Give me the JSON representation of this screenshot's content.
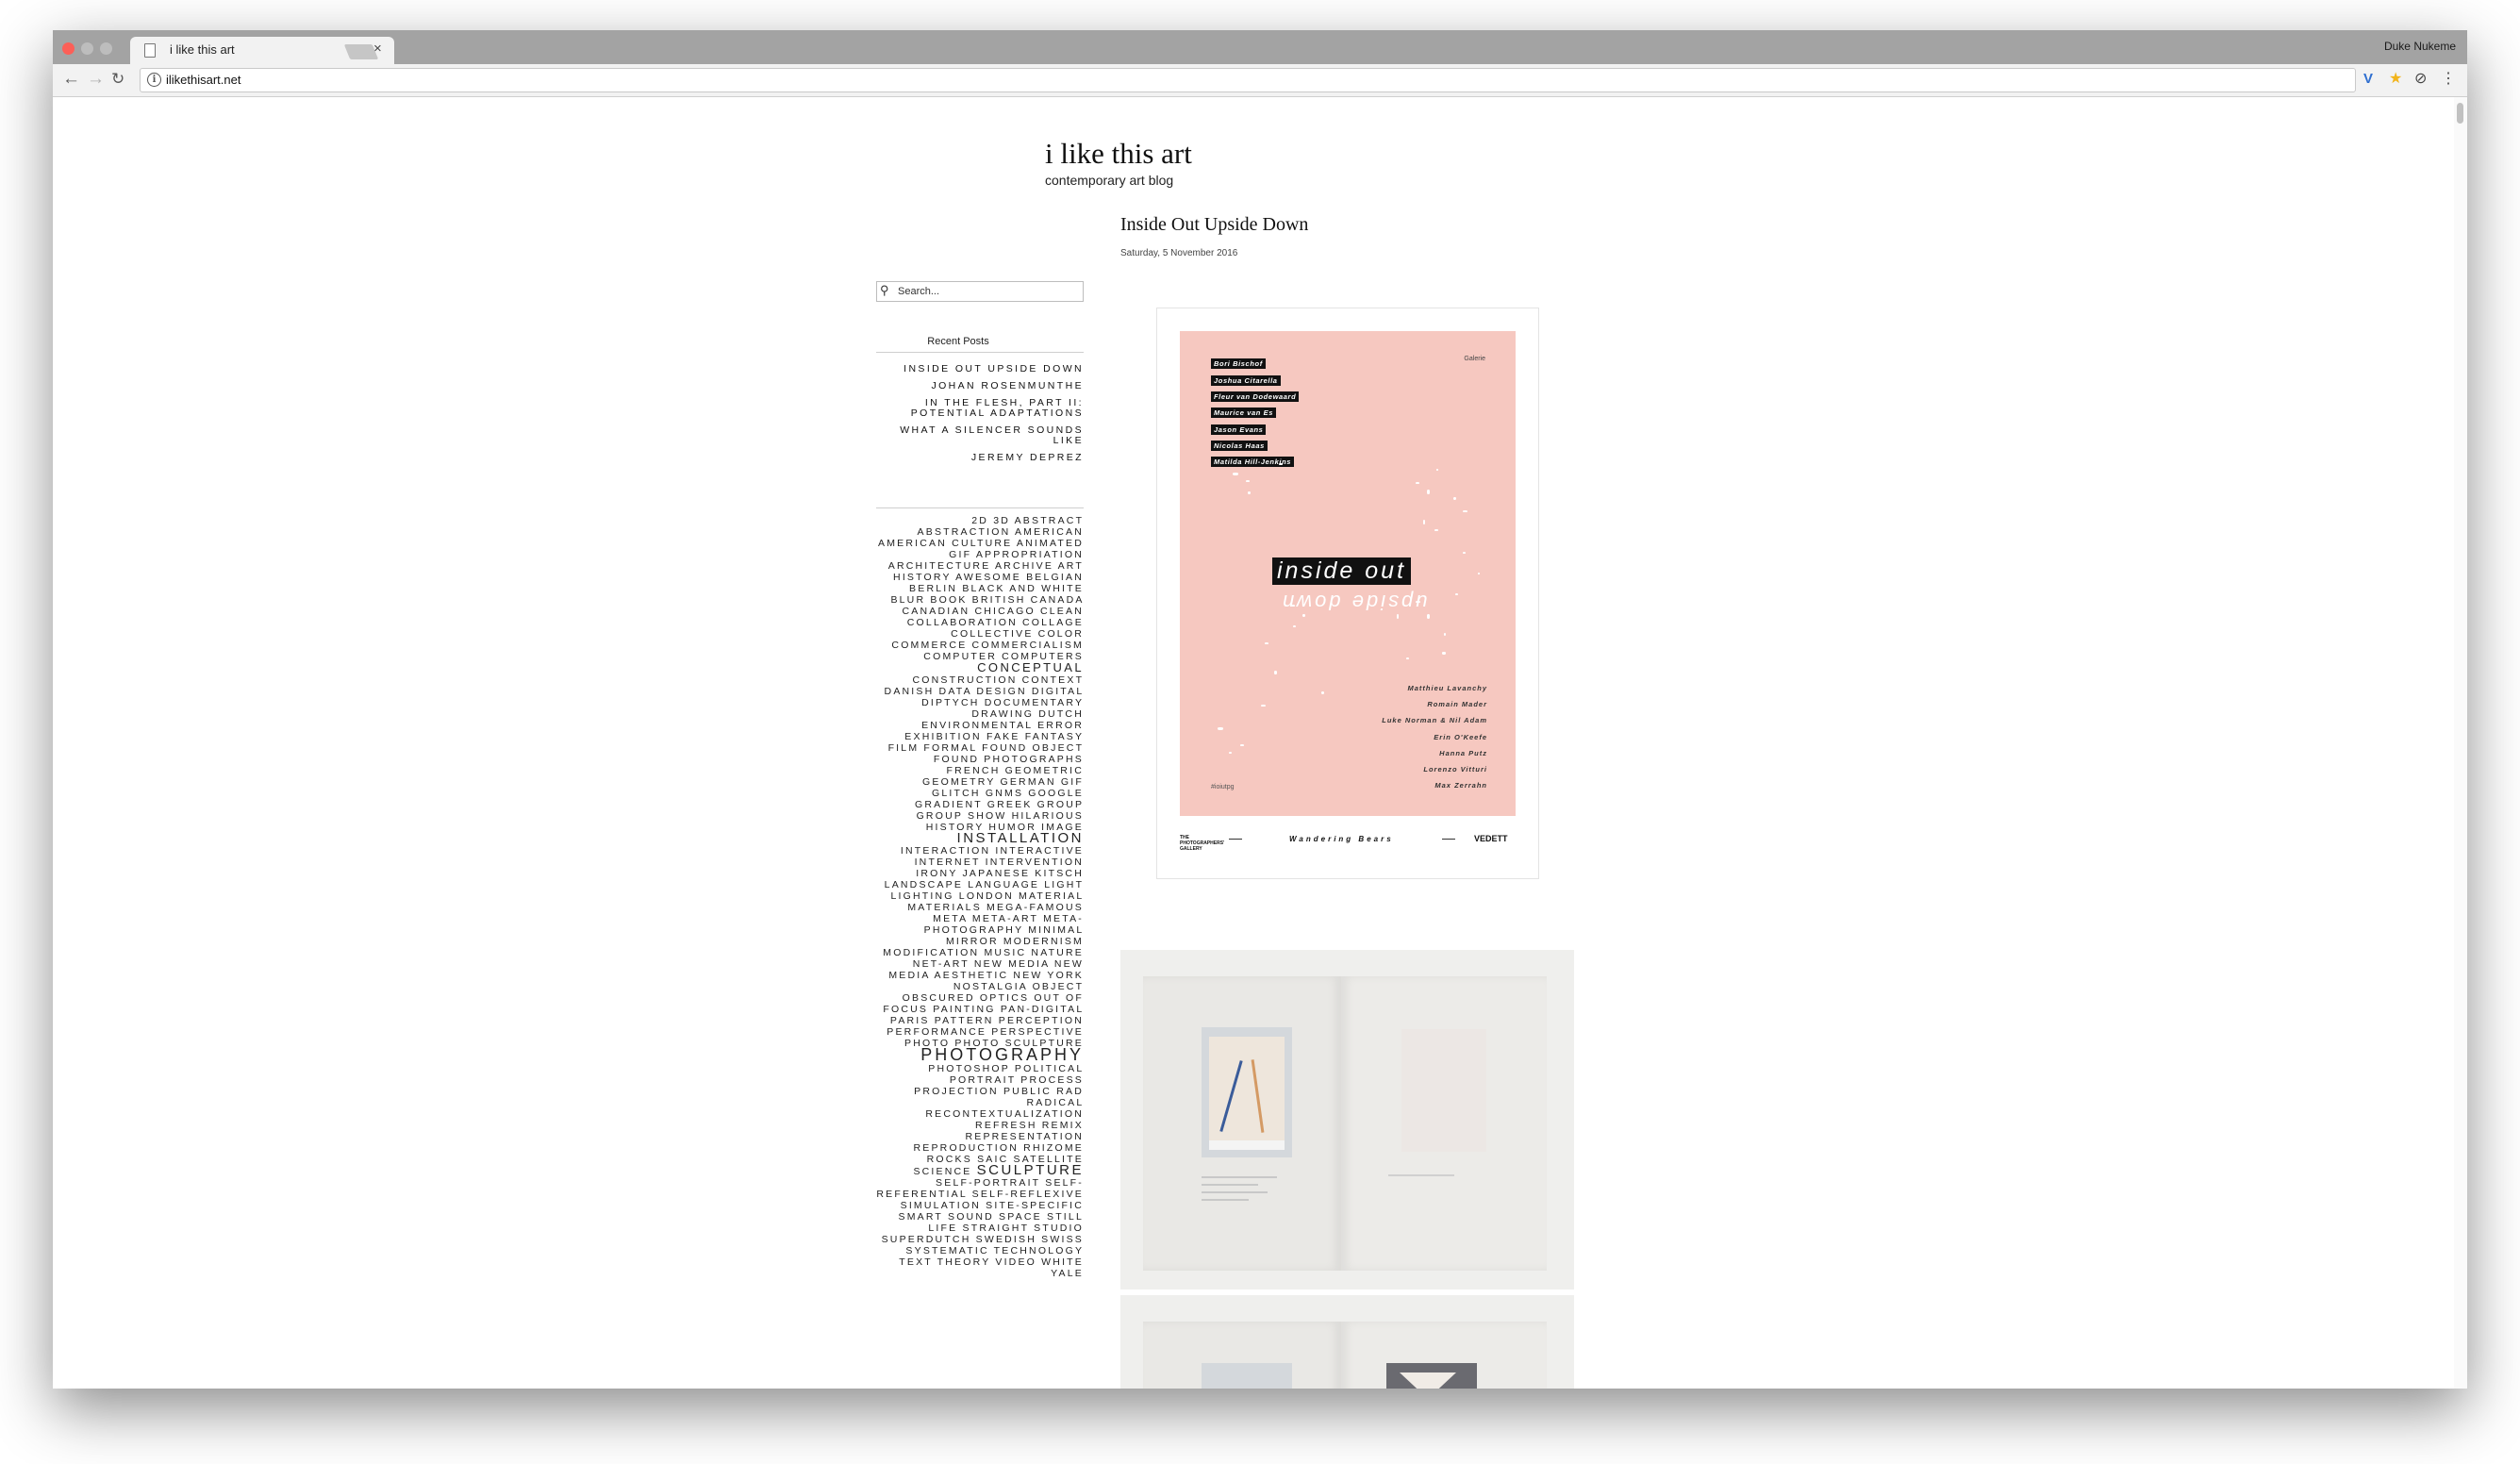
{
  "browser": {
    "tab_title": "i like this art",
    "url": "ilikethisart.net",
    "profile_name": "Duke Nukeme"
  },
  "site": {
    "title": "i like this art",
    "subtitle": "contemporary art blog"
  },
  "post": {
    "title": "Inside Out Upside Down",
    "date": "Saturday, 5 November 2016"
  },
  "search": {
    "placeholder": "Search..."
  },
  "recent_posts": {
    "heading": "Recent Posts",
    "items": [
      "INSIDE OUT UPSIDE DOWN",
      "JOHAN ROSENMUNTHE",
      "IN THE FLESH, PART II: POTENTIAL ADAPTATIONS",
      "WHAT A SILENCER SOUNDS LIKE",
      "JEREMY DEPREZ"
    ]
  },
  "tags": [
    "2D",
    "3D",
    "ABSTRACT",
    "ABSTRACTION",
    "AMERICAN",
    "AMERICAN CULTURE",
    "ANIMATED GIF",
    "APPROPRIATION",
    "ARCHITECTURE",
    "ARCHIVE",
    "ART HISTORY",
    "AWESOME",
    "BELGIAN",
    "BERLIN",
    "BLACK AND WHITE",
    "BLUR",
    "BOOK",
    "BRITISH",
    "CANADA",
    "CANADIAN",
    "CHICAGO",
    "CLEAN",
    "COLLABORATION",
    "COLLAGE",
    "COLLECTIVE",
    "COLOR",
    "COMMERCE",
    "COMMERCIALISM",
    "COMPUTER",
    "COMPUTERS",
    "CONCEPTUAL",
    "CONSTRUCTION",
    "CONTEXT",
    "DANISH",
    "DATA",
    "DESIGN",
    "DIGITAL",
    "DIPTYCH",
    "DOCUMENTARY",
    "DRAWING",
    "DUTCH",
    "ENVIRONMENTAL",
    "ERROR",
    "EXHIBITION",
    "FAKE",
    "FANTASY",
    "FILM",
    "FORMAL",
    "FOUND OBJECT",
    "FOUND PHOTOGRAPHS",
    "FRENCH",
    "GEOMETRIC",
    "GEOMETRY",
    "GERMAN",
    "GIF",
    "GLITCH",
    "GNMS",
    "GOOGLE",
    "GRADIENT",
    "GREEK",
    "GROUP",
    "GROUP SHOW",
    "HILARIOUS",
    "HISTORY",
    "HUMOR",
    "IMAGE",
    "INSTALLATION",
    "INTERACTION",
    "INTERACTIVE",
    "INTERNET",
    "INTERVENTION",
    "IRONY",
    "JAPANESE",
    "KITSCH",
    "LANDSCAPE",
    "LANGUAGE",
    "LIGHT",
    "LIGHTING",
    "LONDON",
    "MATERIAL",
    "MATERIALS",
    "MEGA-FAMOUS",
    "META",
    "META-ART",
    "META-PHOTOGRAPHY",
    "MINIMAL",
    "MIRROR",
    "MODERNISM",
    "MODIFICATION",
    "MUSIC",
    "NATURE",
    "NET-ART",
    "NEW MEDIA",
    "NEW MEDIA AESTHETIC",
    "NEW YORK",
    "NOSTALGIA",
    "OBJECT",
    "OBSCURED",
    "OPTICS",
    "OUT OF FOCUS",
    "PAINTING",
    "PAN-DIGITAL",
    "PARIS",
    "PATTERN",
    "PERCEPTION",
    "PERFORMANCE",
    "PERSPECTIVE",
    "PHOTO",
    "PHOTO SCULPTURE",
    "PHOTOGRAPHY",
    "PHOTOSHOP",
    "POLITICAL",
    "PORTRAIT",
    "PROCESS",
    "PROJECTION",
    "PUBLIC",
    "RAD",
    "RADICAL",
    "RECONTEXTUALIZATION",
    "REFRESH",
    "REMIX",
    "REPRESENTATION",
    "REPRODUCTION",
    "RHIZOME",
    "ROCKS",
    "SAIC",
    "SATELLITE",
    "SCIENCE",
    "SCULPTURE",
    "SELF-PORTRAIT",
    "SELF-REFERENTIAL",
    "SELF-REFLEXIVE",
    "SIMULATION",
    "SITE-SPECIFIC",
    "SMART",
    "SOUND",
    "SPACE",
    "STILL LIFE",
    "STRAIGHT",
    "STUDIO",
    "SUPERDUTCH",
    "SWEDISH",
    "SWISS",
    "SYSTEMATIC",
    "TECHNOLOGY",
    "TEXT",
    "THEORY",
    "VIDEO",
    "WHITE",
    "YALE"
  ],
  "tag_sizes": {
    "CONCEPTUAL": "mid",
    "INSTALLATION": "big",
    "PHOTOGRAPHY": "huge",
    "SCULPTURE": "big"
  },
  "poster": {
    "artists": [
      "Bori Bischof",
      "Joshua Citarella",
      "Fleur van Dodewaard",
      "Maurice van Es",
      "Jason Evans",
      "Nicolas Haas",
      "Matilda Hill-Jenkins"
    ],
    "badge": "Galerie",
    "title": "inside out",
    "flipped": "upside down",
    "credits": [
      "Matthieu Lavanchy",
      "Romain Mader",
      "Luke Norman & Nil Adam",
      "Erin O'Keefe",
      "Hanna Putz",
      "Lorenzo Vitturi",
      "Max Zerrahn"
    ],
    "hashtag": "#ioiutpg",
    "footer_left": "THE PHOTOGRAPHERS' GALLERY",
    "footer_mid": "Wandering Bears",
    "footer_right": "VEDETT"
  },
  "colors": {
    "poster_pink": "#f6c8c0",
    "chrome_gray": "#a3a3a3"
  }
}
